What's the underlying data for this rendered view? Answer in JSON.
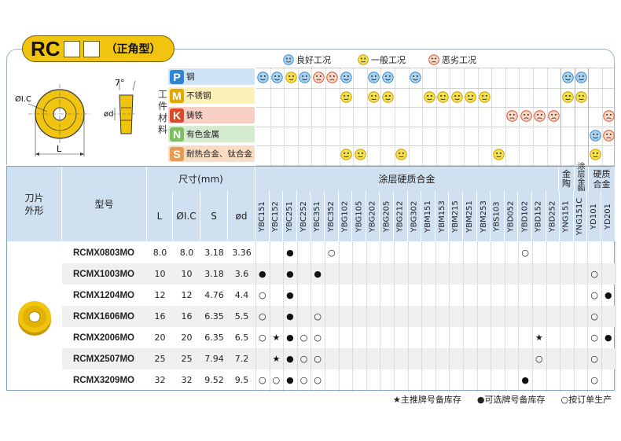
{
  "header": {
    "code": "RC",
    "subtitle": "（正角型）"
  },
  "legend": {
    "good": "良好工况",
    "normal": "一般工况",
    "bad": "恶劣工况"
  },
  "drawing": {
    "angle": "7°",
    "ic": "ØI.C",
    "d": "ød",
    "l": "L"
  },
  "material_label": "工件材料",
  "materials": [
    {
      "letter": "P",
      "name": "钢",
      "bg": "#cde4f6",
      "color": "#2e86d4"
    },
    {
      "letter": "M",
      "name": "不锈钢",
      "bg": "#fdf1b8",
      "color": "#e0a800"
    },
    {
      "letter": "K",
      "name": "铸铁",
      "bg": "#f8cfc4",
      "color": "#d9492a"
    },
    {
      "letter": "N",
      "name": "有色金属",
      "bg": "#d6ecd0",
      "color": "#7cbf62"
    },
    {
      "letter": "S",
      "name": "耐热合金、钛合金",
      "bg": "#f8dcc4",
      "color": "#e79a52"
    }
  ],
  "headers": {
    "shape": "刀片外形",
    "model": "型号",
    "size": "尺寸(mm)",
    "dims": [
      "L",
      "ØI.C",
      "S",
      "ød"
    ],
    "coated": "涂层硬质合金",
    "cermet": "金陶",
    "coated_cermet": "涂层金陶",
    "carbide": "硬质合金"
  },
  "grades": [
    "YBC151",
    "YBC152",
    "YBC251",
    "YBC252",
    "YBC351",
    "YBC352",
    "YBG102",
    "YBG105",
    "YBG202",
    "YBG205",
    "YBG212",
    "YBG302",
    "YBM151",
    "YBM153",
    "YBM215",
    "YBM251",
    "YBM253",
    "YBS103",
    "YBD052",
    "YBD102",
    "YBD152",
    "YBD252",
    "YNG151",
    "YNG151C",
    "YD101",
    "YD201"
  ],
  "smileys": [
    [
      [
        "YBC151",
        "good"
      ],
      [
        "YBC152",
        "good"
      ],
      [
        "YBC251",
        "normal"
      ],
      [
        "YBC252",
        "good"
      ],
      [
        "YBC351",
        "bad"
      ],
      [
        "YBC352",
        "bad"
      ],
      [
        "YBG102",
        "good"
      ],
      [
        "YBG202",
        "good"
      ],
      [
        "YBG205",
        "good"
      ],
      [
        "YBG302",
        "good"
      ],
      [
        "YNG151",
        "good"
      ],
      [
        "YNG151C",
        "good"
      ]
    ],
    [
      [
        "YBG102",
        "normal"
      ],
      [
        "YBG202",
        "normal"
      ],
      [
        "YBG205",
        "normal"
      ],
      [
        "YBM151",
        "normal"
      ],
      [
        "YBM153",
        "normal"
      ],
      [
        "YBM215",
        "normal"
      ],
      [
        "YBM251",
        "normal"
      ],
      [
        "YBM253",
        "normal"
      ],
      [
        "YNG151",
        "normal"
      ],
      [
        "YNG151C",
        "normal"
      ]
    ],
    [
      [
        "YBD052",
        "bad"
      ],
      [
        "YBD102",
        "bad"
      ],
      [
        "YBD152",
        "bad"
      ],
      [
        "YBD252",
        "bad"
      ],
      [
        "YD201",
        "bad"
      ]
    ],
    [
      [
        "YD101",
        "good"
      ],
      [
        "YD201",
        "bad"
      ]
    ],
    [
      [
        "YBG102",
        "normal"
      ],
      [
        "YBG105",
        "normal"
      ],
      [
        "YBG212",
        "normal"
      ],
      [
        "YBS103",
        "normal"
      ],
      [
        "YD101",
        "normal"
      ]
    ]
  ],
  "rows": [
    {
      "model": "RCMX0803MO",
      "L": "8.0",
      "IC": "8.0",
      "S": "3.18",
      "d": "3.36",
      "marks": [
        [
          "YBC251",
          "●"
        ],
        [
          "YBC352",
          "○"
        ],
        [
          "YBD102",
          "○"
        ]
      ]
    },
    {
      "model": "RCMX1003MO",
      "L": "10",
      "IC": "10",
      "S": "3.18",
      "d": "3.6",
      "marks": [
        [
          "YBC151",
          "●"
        ],
        [
          "YBC251",
          "●"
        ],
        [
          "YBC351",
          "●"
        ],
        [
          "YD101",
          "○"
        ]
      ]
    },
    {
      "model": "RCMX1204MO",
      "L": "12",
      "IC": "12",
      "S": "4.76",
      "d": "4.4",
      "marks": [
        [
          "YBC151",
          "○"
        ],
        [
          "YBC251",
          "●"
        ],
        [
          "YD101",
          "○"
        ],
        [
          "YD201",
          "●"
        ]
      ]
    },
    {
      "model": "RCMX1606MO",
      "L": "16",
      "IC": "16",
      "S": "6.35",
      "d": "5.5",
      "marks": [
        [
          "YBC151",
          "○"
        ],
        [
          "YBC251",
          "●"
        ],
        [
          "YBC351",
          "○"
        ],
        [
          "YD101",
          "○"
        ]
      ]
    },
    {
      "model": "RCMX2006MO",
      "L": "20",
      "IC": "20",
      "S": "6.35",
      "d": "6.5",
      "marks": [
        [
          "YBC151",
          "○"
        ],
        [
          "YBC152",
          "★"
        ],
        [
          "YBC251",
          "●"
        ],
        [
          "YBC252",
          "○"
        ],
        [
          "YBC351",
          "○"
        ],
        [
          "YBD152",
          "★"
        ],
        [
          "YD101",
          "○"
        ],
        [
          "YD201",
          "●"
        ]
      ]
    },
    {
      "model": "RCMX2507MO",
      "L": "25",
      "IC": "25",
      "S": "7.94",
      "d": "7.2",
      "marks": [
        [
          "YBC152",
          "★"
        ],
        [
          "YBC251",
          "●"
        ],
        [
          "YBC252",
          "○"
        ],
        [
          "YBC351",
          "○"
        ],
        [
          "YBD152",
          "○"
        ],
        [
          "YD101",
          "○"
        ]
      ]
    },
    {
      "model": "RCMX3209MO",
      "L": "32",
      "IC": "32",
      "S": "9.52",
      "d": "9.5",
      "marks": [
        [
          "YBC151",
          "○"
        ],
        [
          "YBC152",
          "○"
        ],
        [
          "YBC251",
          "●"
        ],
        [
          "YBC252",
          "○"
        ],
        [
          "YBC351",
          "○"
        ],
        [
          "YBD102",
          "●"
        ],
        [
          "YD101",
          "○"
        ]
      ]
    }
  ],
  "footer": {
    "star": "★主推牌号备库存",
    "dot": "●可选牌号备库存",
    "circle": "○按订单生产"
  }
}
